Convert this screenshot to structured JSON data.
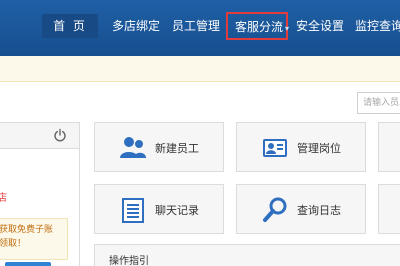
{
  "nav": {
    "home": "首 页",
    "multi_store": "多店绑定",
    "staff": "员工管理",
    "cs_routing": "客服分流",
    "security": "安全设置",
    "monitor": "监控查询"
  },
  "search": {
    "placeholder": "请输入员工"
  },
  "left_panel": {
    "red_text": "店",
    "promo_line1": "获取免费子账",
    "promo_line2": "领取！"
  },
  "cards": {
    "new_staff": "新建员工",
    "manage_posts": "管理岗位",
    "chat_records": "聊天记录",
    "query_logs": "查询日志"
  },
  "guide": {
    "title": "操作指引"
  },
  "colors": {
    "header_blue": "#1a5799",
    "icon_blue": "#2f6fc0",
    "highlight_red": "#e23b3b",
    "notice_bg": "#fdf9ea"
  }
}
